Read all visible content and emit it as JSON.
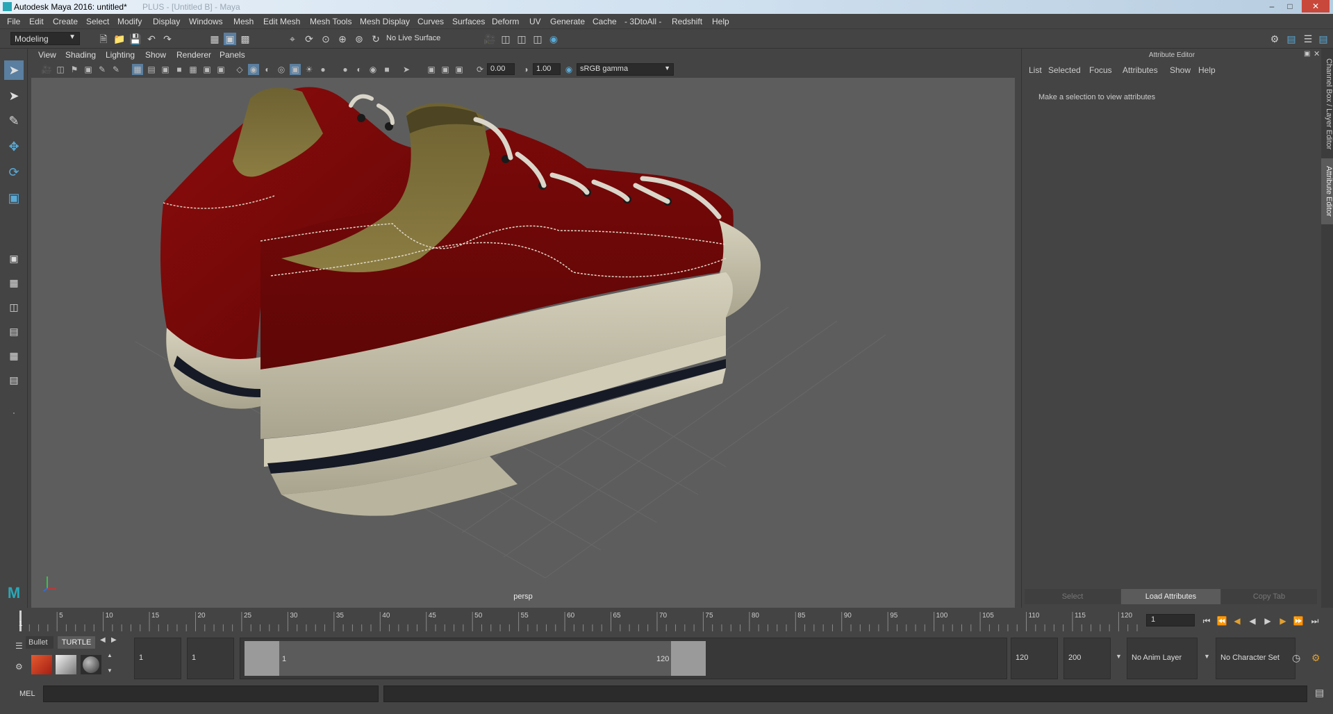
{
  "window": {
    "title": "Autodesk Maya 2016: untitled*",
    "ghost_title": "PLUS - [Untitled B] - Maya"
  },
  "menubar": [
    "File",
    "Edit",
    "Create",
    "Select",
    "Modify",
    "Display",
    "Windows",
    "Mesh",
    "Edit Mesh",
    "Mesh Tools",
    "Mesh Display",
    "Curves",
    "Surfaces",
    "Deform",
    "UV",
    "Generate",
    "Cache",
    "- 3DtoAll -",
    "Redshift",
    "Help"
  ],
  "toolbar": {
    "mode": "Modeling",
    "live_surface": "No Live Surface"
  },
  "viewport": {
    "menus": [
      "View",
      "Shading",
      "Lighting",
      "Show",
      "Renderer",
      "Panels"
    ],
    "exposure": "0.00",
    "gamma": "1.00",
    "color_space": "sRGB gamma",
    "camera_label": "persp"
  },
  "attribute_editor": {
    "title": "Attribute Editor",
    "menus": [
      "List",
      "Selected",
      "Focus",
      "Attributes",
      "Show",
      "Help"
    ],
    "message": "Make a selection to view attributes",
    "buttons": {
      "select": "Select",
      "load": "Load Attributes",
      "copy": "Copy Tab"
    },
    "side_tabs": [
      "Channel Box / Layer Editor",
      "Attribute Editor"
    ]
  },
  "timeline": {
    "ticks": [
      "5",
      "10",
      "15",
      "20",
      "25",
      "30",
      "35",
      "40",
      "45",
      "50",
      "55",
      "60",
      "65",
      "70",
      "75",
      "80",
      "85",
      "90",
      "95",
      "100",
      "105",
      "110",
      "115",
      "120"
    ],
    "start_marker": "1",
    "current_frame": "1"
  },
  "range": {
    "shelf_tabs": [
      "Bullet",
      "TURTLE"
    ],
    "start": "1",
    "playback_start": "1",
    "range_start_label": "1",
    "range_end_label": "120",
    "playback_end": "120",
    "end": "200",
    "anim_layer": "No Anim Layer",
    "character_set": "No Character Set"
  },
  "command_line": {
    "label": "MEL"
  },
  "colors": {
    "accent": "#5aaad6",
    "canvas_red": "#7a0a0a",
    "sole": "#c8c3ad",
    "stripe": "#161a26"
  }
}
